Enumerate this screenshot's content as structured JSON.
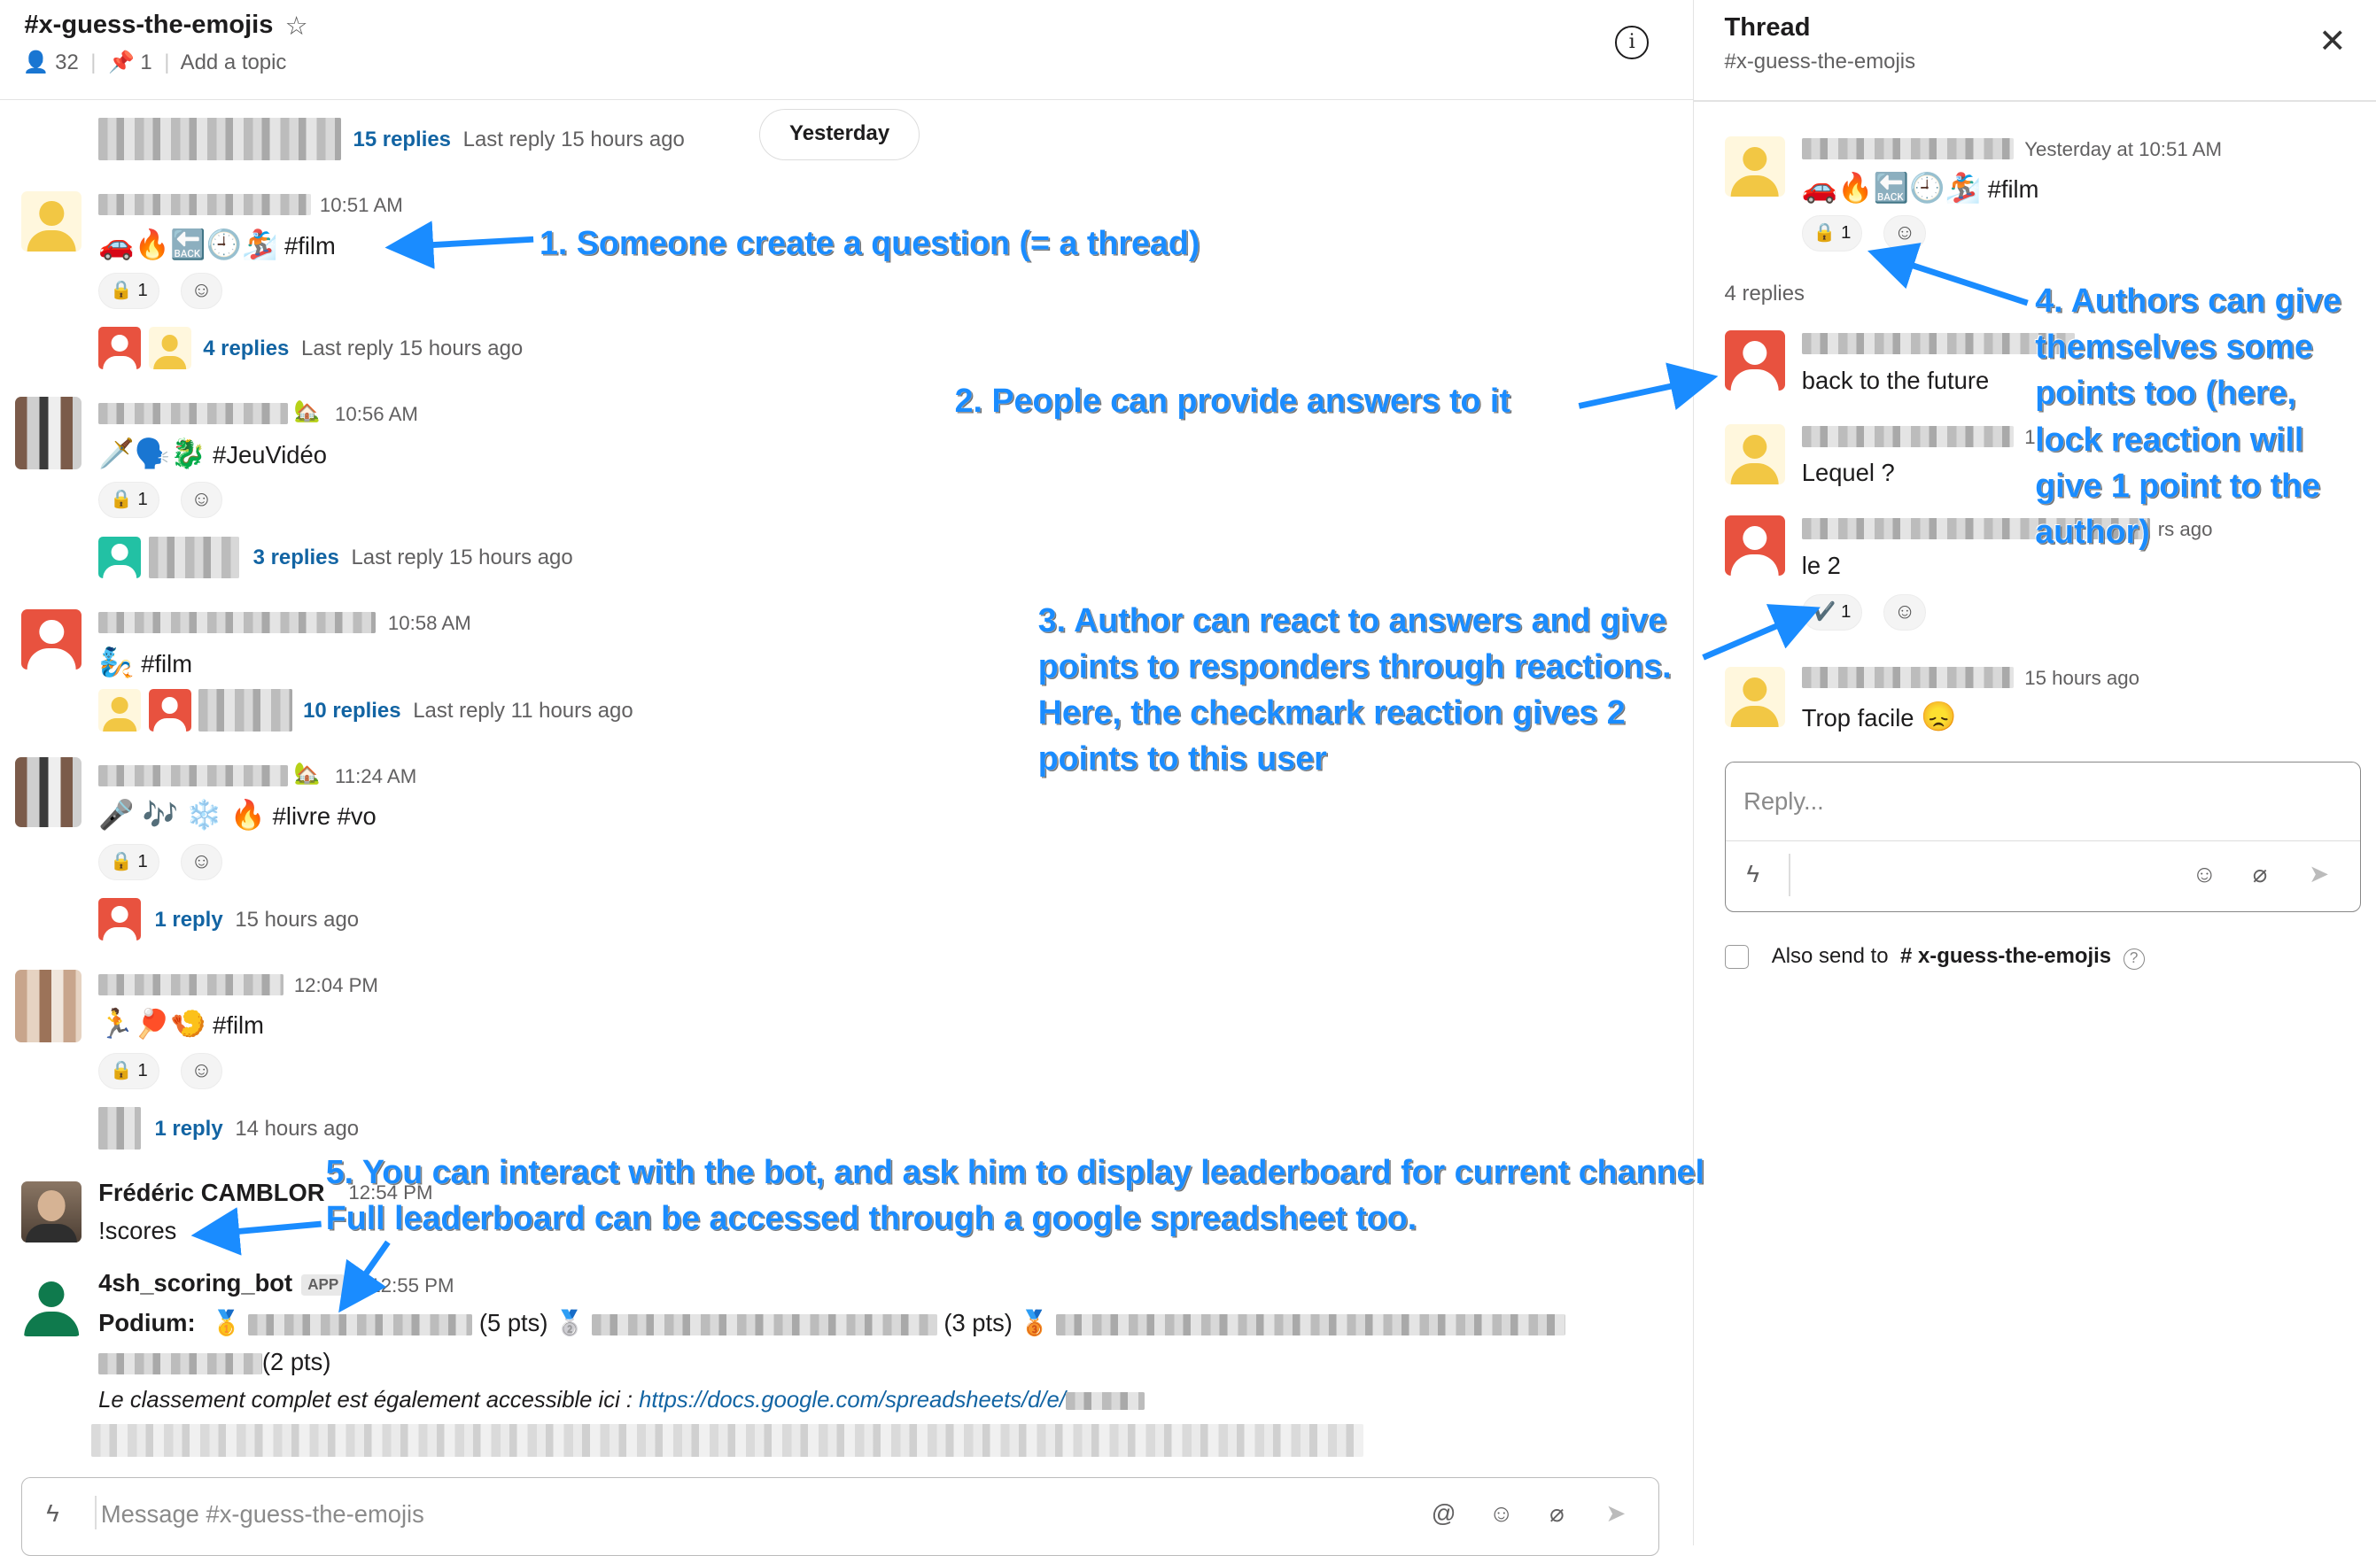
{
  "channel": {
    "name": "#x-guess-the-emojis",
    "members": "32",
    "pins": "1",
    "topic": "Add a topic",
    "divider_label": "Yesterday"
  },
  "messages": [
    {
      "replies": "15 replies",
      "last": "Last reply 15 hours ago"
    },
    {
      "time": "10:51 AM",
      "emojis": "🚗🔥🔙🕘🏂",
      "text": "#film",
      "reaction": "1",
      "replies": "4 replies",
      "last": "Last reply 15 hours ago"
    },
    {
      "time": "10:56 AM",
      "emojis": "🗡️🗣️🐉",
      "text": "#JeuVidéo",
      "reaction": "1",
      "replies": "3 replies",
      "last": "Last reply 15 hours ago"
    },
    {
      "time": "10:58 AM",
      "emojis": "🧞",
      "text": "#film",
      "replies": "10 replies",
      "last": "Last reply 11 hours ago"
    },
    {
      "time": "11:24 AM",
      "emojis": "🎤 🎶 ❄️ 🔥",
      "text": "#livre #vo",
      "reaction": "1",
      "replies": "1 reply",
      "last": "15 hours ago"
    },
    {
      "time": "12:04 PM",
      "emojis": "🏃🏓🍤",
      "text": "#film",
      "reaction": "1",
      "replies": "1 reply",
      "last": "14 hours ago"
    },
    {
      "name": "Frédéric CAMBLOR",
      "time": "12:54 PM",
      "text": "!scores"
    },
    {
      "name": "4sh_scoring_bot",
      "badge": "APP",
      "time": "12:55 PM",
      "podium_label": "Podium:",
      "pts1": "(5 pts)",
      "pts2": "(3 pts)",
      "pts3": "(2 pts)",
      "note": "Le classement complet est également accessible ici : ",
      "link": "https://docs.google.com/spreadsheets/d/e/"
    }
  ],
  "composer": {
    "placeholder": "Message #x-guess-the-emojis"
  },
  "thread": {
    "title": "Thread",
    "channel": "#x-guess-the-emojis",
    "root_time": "Yesterday at 10:51 AM",
    "root_emojis": "🚗🔥🔙🕘🏂",
    "root_text": "#film",
    "root_reaction": "1",
    "reply_count": "4 replies",
    "replies": [
      {
        "text": "back to the future"
      },
      {
        "time_frag": "1",
        "text": "Lequel ?"
      },
      {
        "time_frag": "rs ago",
        "text": "le 2",
        "reaction_emoji": "✔️",
        "reaction": "1"
      },
      {
        "time": "15 hours ago",
        "text": "Trop facile",
        "emoji": "😞"
      }
    ],
    "reply_placeholder": "Reply...",
    "also_send_label": "Also send to",
    "also_send_channel": "# x-guess-the-emojis"
  },
  "annotations": {
    "a1": "1. Someone create a question (= a thread)",
    "a2": "2. People can provide answers to it",
    "a3": [
      "3. Author can react to answers and give",
      "points to responders through reactions.",
      "Here, the checkmark reaction gives 2",
      "points to this user"
    ],
    "a4": [
      "4. Authors can give",
      "themselves some",
      "points too (here,",
      "lock reaction will",
      "give 1 point to the",
      "author)"
    ],
    "a5": [
      "5. You can interact with the bot, and ask him to display leaderboard for current channel",
      "Full leaderboard can be accessed through a google spreadsheet too."
    ]
  },
  "colors": {
    "link": "#1264a3",
    "annotation": "#1a8cff",
    "avatar_red": "#e8523f",
    "avatar_yellow": "#f2c744",
    "bot_green": "#0f7a4d"
  },
  "icons": [
    "person-icon",
    "pin-icon",
    "star-icon",
    "info-icon",
    "close-icon",
    "lock-icon",
    "add-reaction-icon",
    "lightning-icon",
    "at-icon",
    "emoji-icon",
    "attachment-icon",
    "send-icon",
    "help-icon",
    "medal-gold-icon",
    "medal-silver-icon",
    "medal-bronze-icon"
  ]
}
